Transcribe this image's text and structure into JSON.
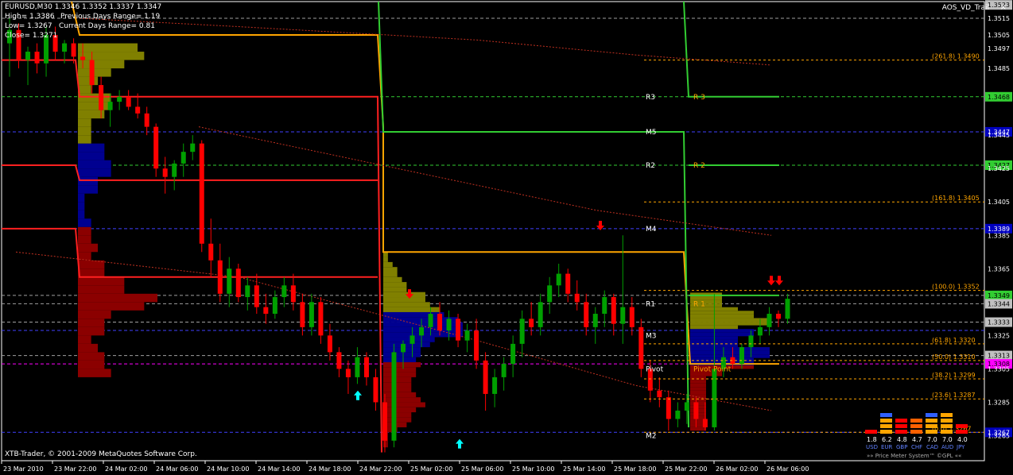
{
  "header": {
    "symbol_line": "EURUSD,M30  1.3346 1.3352 1.3337 1.3347",
    "high": "High= 1.3386",
    "prev_range": "Previous Days Range= 1.19",
    "low": "Low= 1.3267",
    "cur_range": "Current Days Range= 0.81",
    "close": "Close= 1.3271"
  },
  "indicator": {
    "name": "AOS_VD_Trail",
    "close_glyph": "×"
  },
  "copyright": "XTB-Trader, © 2001-2009 MetaQuotes Software Corp.",
  "colors": {
    "background": "#000000",
    "bull": "#00a000",
    "bear": "#ff0000",
    "orange": "#ffa500",
    "green_line": "#32cd32",
    "red_line": "#ff2020",
    "blue_dash": "#3030c0",
    "vp_olive": "#808000",
    "vp_navy": "#000090",
    "vp_maroon": "#8b0000",
    "cyan": "#00ffff",
    "magenta": "#ff00ff",
    "axis_label_bg": "#c0c0c0"
  },
  "chart_data": {
    "type": "candlestick",
    "symbol": "EURUSD",
    "timeframe": "M30",
    "ylim": [
      1.325,
      1.3525
    ],
    "price_labels": [
      {
        "text": "1.3523",
        "value": 1.3523,
        "bg": "#c0c0c0",
        "fg": "#000"
      },
      {
        "text": "1.3515",
        "value": 1.3515,
        "bg": "#000",
        "fg": "#fff"
      },
      {
        "text": "1.3505",
        "value": 1.3505,
        "bg": "#000",
        "fg": "#fff"
      },
      {
        "text": "1.3497",
        "value": 1.3497,
        "bg": "#000",
        "fg": "#fff"
      },
      {
        "text": "1.3485",
        "value": 1.3485,
        "bg": "#000",
        "fg": "#fff"
      },
      {
        "text": "1.3468",
        "value": 1.3468,
        "bg": "#32cd32",
        "fg": "#000"
      },
      {
        "text": "1.3447",
        "value": 1.3447,
        "bg": "#0000c0",
        "fg": "#fff"
      },
      {
        "text": "1.3445",
        "value": 1.3445,
        "bg": "#000",
        "fg": "#fff"
      },
      {
        "text": "1.3427",
        "value": 1.3427,
        "bg": "#32cd32",
        "fg": "#000"
      },
      {
        "text": "1.3425",
        "value": 1.3425,
        "bg": "#000",
        "fg": "#fff"
      },
      {
        "text": "1.3405",
        "value": 1.3405,
        "bg": "#000",
        "fg": "#fff"
      },
      {
        "text": "1.3389",
        "value": 1.3389,
        "bg": "#0000c0",
        "fg": "#fff"
      },
      {
        "text": "1.3385",
        "value": 1.3385,
        "bg": "#000",
        "fg": "#fff"
      },
      {
        "text": "1.3365",
        "value": 1.3365,
        "bg": "#000",
        "fg": "#fff"
      },
      {
        "text": "1.3349",
        "value": 1.3349,
        "bg": "#32cd32",
        "fg": "#000"
      },
      {
        "text": "1.3344",
        "value": 1.3344,
        "bg": "#c0c0c0",
        "fg": "#000"
      },
      {
        "text": "1.3333",
        "value": 1.3333,
        "bg": "#c0c0c0",
        "fg": "#000"
      },
      {
        "text": "1.3325",
        "value": 1.3325,
        "bg": "#000",
        "fg": "#fff"
      },
      {
        "text": "1.3313",
        "value": 1.3313,
        "bg": "#c0c0c0",
        "fg": "#000"
      },
      {
        "text": "1.3308",
        "value": 1.3308,
        "bg": "#ff00ff",
        "fg": "#000"
      },
      {
        "text": "1.3305",
        "value": 1.3305,
        "bg": "#000",
        "fg": "#fff"
      },
      {
        "text": "1.3285",
        "value": 1.3285,
        "bg": "#000",
        "fg": "#fff"
      },
      {
        "text": "1.3267",
        "value": 1.3267,
        "bg": "#0000c0",
        "fg": "#fff"
      },
      {
        "text": "1.3265",
        "value": 1.3265,
        "bg": "#000",
        "fg": "#fff"
      }
    ],
    "x_labels": [
      "23 Mar 2010",
      "23 Mar 22:00",
      "24 Mar 02:00",
      "24 Mar 06:00",
      "24 Mar 10:00",
      "24 Mar 14:00",
      "24 Mar 18:00",
      "24 Mar 22:00",
      "25 Mar 02:00",
      "25 Mar 06:00",
      "25 Mar 10:00",
      "25 Mar 14:00",
      "25 Mar 18:00",
      "25 Mar 22:00",
      "26 Mar 02:00",
      "26 Mar 06:00"
    ],
    "horizontal_levels": [
      {
        "value": 1.3515,
        "color": "#a0a0a0",
        "dash": true
      },
      {
        "value": 1.3468,
        "color": "#32cd32",
        "dash": true
      },
      {
        "value": 1.3447,
        "color": "#4040ff",
        "dash": true
      },
      {
        "value": 1.3427,
        "color": "#32cd32",
        "dash": true
      },
      {
        "value": 1.3389,
        "color": "#4040ff",
        "dash": true
      },
      {
        "value": 1.3349,
        "color": "#a0a0a0",
        "dash": true
      },
      {
        "value": 1.3344,
        "color": "#a0a0a0",
        "dash": true
      },
      {
        "value": 1.3333,
        "color": "#a0a0a0",
        "dash": true
      },
      {
        "value": 1.3328,
        "color": "#4040ff",
        "dash": true
      },
      {
        "value": 1.3313,
        "color": "#a0a0a0",
        "dash": true
      },
      {
        "value": 1.3308,
        "color": "#ff00ff",
        "dash": true
      },
      {
        "value": 1.3267,
        "color": "#4040ff",
        "dash": true
      }
    ],
    "pivot_labels": [
      {
        "text": "R3",
        "value": 1.3468
      },
      {
        "text": "M5",
        "value": 1.3447
      },
      {
        "text": "R2",
        "value": 1.3427
      },
      {
        "text": "M4",
        "value": 1.3389
      },
      {
        "text": "R1",
        "value": 1.3344
      },
      {
        "text": "M3",
        "value": 1.3325
      },
      {
        "text": "Pivot",
        "value": 1.3305
      },
      {
        "text": "M2",
        "value": 1.3265
      }
    ],
    "orange_pivot_labels": [
      {
        "text": "R 3",
        "value": 1.3468
      },
      {
        "text": "R 2",
        "value": 1.3427
      },
      {
        "text": "R 1",
        "value": 1.3344
      },
      {
        "text": "Pivot Point",
        "value": 1.3305
      }
    ],
    "fib_levels": [
      {
        "text": "(261.8)  1.3490",
        "value": 1.349
      },
      {
        "text": "(161.8)  1.3405",
        "value": 1.3405
      },
      {
        "text": "(100.0)  1.3352",
        "value": 1.3352
      },
      {
        "text": "(61.8)  1.3320",
        "value": 1.332
      },
      {
        "text": "(50.0)  1.3310",
        "value": 1.331
      },
      {
        "text": "(38.2)  1.3299",
        "value": 1.3299
      },
      {
        "text": "(23.6)  1.3287",
        "value": 1.3287
      },
      {
        "text": "(0.0)  1.3267",
        "value": 1.3267
      }
    ],
    "currency_meter": {
      "values": [
        "1.8",
        "6.2",
        "4.8",
        "4.7",
        "7.0",
        "7.0",
        "4.0"
      ],
      "currencies": [
        "USD",
        "EUR",
        "GBP",
        "CHF",
        "CAD",
        "AUD",
        "JPY"
      ],
      "caption": "»» Price Meter System™ ©GPL ««"
    },
    "candles": [
      {
        "o": 1.35,
        "h": 1.3515,
        "l": 1.348,
        "c": 1.3508
      },
      {
        "o": 1.3508,
        "h": 1.3512,
        "l": 1.3485,
        "c": 1.349
      },
      {
        "o": 1.349,
        "h": 1.3498,
        "l": 1.3475,
        "c": 1.3495
      },
      {
        "o": 1.3495,
        "h": 1.35,
        "l": 1.3482,
        "c": 1.3488
      },
      {
        "o": 1.3488,
        "h": 1.351,
        "l": 1.348,
        "c": 1.3505
      },
      {
        "o": 1.3505,
        "h": 1.351,
        "l": 1.349,
        "c": 1.3495
      },
      {
        "o": 1.3495,
        "h": 1.3502,
        "l": 1.3488,
        "c": 1.35
      },
      {
        "o": 1.35,
        "h": 1.3503,
        "l": 1.3488,
        "c": 1.3492
      },
      {
        "o": 1.3492,
        "h": 1.35,
        "l": 1.3485,
        "c": 1.349
      },
      {
        "o": 1.349,
        "h": 1.3495,
        "l": 1.347,
        "c": 1.3475
      },
      {
        "o": 1.3475,
        "h": 1.348,
        "l": 1.3455,
        "c": 1.346
      },
      {
        "o": 1.346,
        "h": 1.347,
        "l": 1.345,
        "c": 1.3465
      },
      {
        "o": 1.3465,
        "h": 1.3472,
        "l": 1.346,
        "c": 1.3468
      },
      {
        "o": 1.3468,
        "h": 1.3472,
        "l": 1.346,
        "c": 1.3462
      },
      {
        "o": 1.3462,
        "h": 1.347,
        "l": 1.3455,
        "c": 1.3458
      },
      {
        "o": 1.3458,
        "h": 1.3462,
        "l": 1.3445,
        "c": 1.345
      },
      {
        "o": 1.345,
        "h": 1.3452,
        "l": 1.342,
        "c": 1.3425
      },
      {
        "o": 1.3425,
        "h": 1.3432,
        "l": 1.341,
        "c": 1.342
      },
      {
        "o": 1.342,
        "h": 1.343,
        "l": 1.3412,
        "c": 1.3428
      },
      {
        "o": 1.3428,
        "h": 1.344,
        "l": 1.342,
        "c": 1.3435
      },
      {
        "o": 1.3435,
        "h": 1.3445,
        "l": 1.343,
        "c": 1.344
      },
      {
        "o": 1.344,
        "h": 1.3442,
        "l": 1.3375,
        "c": 1.338
      },
      {
        "o": 1.338,
        "h": 1.3395,
        "l": 1.336,
        "c": 1.337
      },
      {
        "o": 1.337,
        "h": 1.338,
        "l": 1.3345,
        "c": 1.335
      },
      {
        "o": 1.335,
        "h": 1.3372,
        "l": 1.3342,
        "c": 1.3365
      },
      {
        "o": 1.3365,
        "h": 1.3368,
        "l": 1.3345,
        "c": 1.3348
      },
      {
        "o": 1.3348,
        "h": 1.336,
        "l": 1.334,
        "c": 1.3355
      },
      {
        "o": 1.3355,
        "h": 1.3362,
        "l": 1.3338,
        "c": 1.3342
      },
      {
        "o": 1.3342,
        "h": 1.335,
        "l": 1.3332,
        "c": 1.3338
      },
      {
        "o": 1.3338,
        "h": 1.3352,
        "l": 1.3335,
        "c": 1.3348
      },
      {
        "o": 1.3348,
        "h": 1.336,
        "l": 1.3342,
        "c": 1.3355
      },
      {
        "o": 1.3355,
        "h": 1.3362,
        "l": 1.334,
        "c": 1.3345
      },
      {
        "o": 1.3345,
        "h": 1.335,
        "l": 1.3325,
        "c": 1.333
      },
      {
        "o": 1.333,
        "h": 1.335,
        "l": 1.3325,
        "c": 1.3345
      },
      {
        "o": 1.3345,
        "h": 1.3348,
        "l": 1.332,
        "c": 1.3325
      },
      {
        "o": 1.3325,
        "h": 1.3332,
        "l": 1.331,
        "c": 1.3315
      },
      {
        "o": 1.3315,
        "h": 1.3318,
        "l": 1.33,
        "c": 1.3305
      },
      {
        "o": 1.3305,
        "h": 1.331,
        "l": 1.329,
        "c": 1.33
      },
      {
        "o": 1.33,
        "h": 1.3318,
        "l": 1.3296,
        "c": 1.3312
      },
      {
        "o": 1.3312,
        "h": 1.3315,
        "l": 1.3295,
        "c": 1.33
      },
      {
        "o": 1.33,
        "h": 1.3305,
        "l": 1.328,
        "c": 1.3285
      },
      {
        "o": 1.3285,
        "h": 1.329,
        "l": 1.3255,
        "c": 1.3262
      },
      {
        "o": 1.3262,
        "h": 1.332,
        "l": 1.3258,
        "c": 1.3315
      },
      {
        "o": 1.3315,
        "h": 1.3322,
        "l": 1.3305,
        "c": 1.332
      },
      {
        "o": 1.332,
        "h": 1.333,
        "l": 1.3312,
        "c": 1.3325
      },
      {
        "o": 1.3325,
        "h": 1.3335,
        "l": 1.3318,
        "c": 1.333
      },
      {
        "o": 1.333,
        "h": 1.3342,
        "l": 1.3325,
        "c": 1.3338
      },
      {
        "o": 1.3338,
        "h": 1.3345,
        "l": 1.3325,
        "c": 1.3328
      },
      {
        "o": 1.3328,
        "h": 1.334,
        "l": 1.3322,
        "c": 1.3335
      },
      {
        "o": 1.3335,
        "h": 1.3338,
        "l": 1.3318,
        "c": 1.3322
      },
      {
        "o": 1.3322,
        "h": 1.3332,
        "l": 1.3315,
        "c": 1.3328
      },
      {
        "o": 1.3328,
        "h": 1.3335,
        "l": 1.3305,
        "c": 1.331
      },
      {
        "o": 1.331,
        "h": 1.3315,
        "l": 1.328,
        "c": 1.329
      },
      {
        "o": 1.329,
        "h": 1.3305,
        "l": 1.3282,
        "c": 1.33
      },
      {
        "o": 1.33,
        "h": 1.3312,
        "l": 1.3292,
        "c": 1.3308
      },
      {
        "o": 1.3308,
        "h": 1.3325,
        "l": 1.33,
        "c": 1.332
      },
      {
        "o": 1.332,
        "h": 1.334,
        "l": 1.3312,
        "c": 1.3335
      },
      {
        "o": 1.3335,
        "h": 1.3345,
        "l": 1.3325,
        "c": 1.333
      },
      {
        "o": 1.333,
        "h": 1.335,
        "l": 1.3325,
        "c": 1.3345
      },
      {
        "o": 1.3345,
        "h": 1.336,
        "l": 1.3338,
        "c": 1.3355
      },
      {
        "o": 1.3355,
        "h": 1.3368,
        "l": 1.3348,
        "c": 1.3362
      },
      {
        "o": 1.3362,
        "h": 1.3365,
        "l": 1.3345,
        "c": 1.335
      },
      {
        "o": 1.335,
        "h": 1.3358,
        "l": 1.334,
        "c": 1.3345
      },
      {
        "o": 1.3345,
        "h": 1.335,
        "l": 1.3325,
        "c": 1.333
      },
      {
        "o": 1.333,
        "h": 1.3342,
        "l": 1.332,
        "c": 1.3338
      },
      {
        "o": 1.3338,
        "h": 1.3352,
        "l": 1.333,
        "c": 1.3348
      },
      {
        "o": 1.3348,
        "h": 1.335,
        "l": 1.3325,
        "c": 1.3332
      },
      {
        "o": 1.3332,
        "h": 1.3385,
        "l": 1.332,
        "c": 1.3342
      },
      {
        "o": 1.3342,
        "h": 1.3348,
        "l": 1.3325,
        "c": 1.333
      },
      {
        "o": 1.333,
        "h": 1.3335,
        "l": 1.33,
        "c": 1.3305
      },
      {
        "o": 1.3305,
        "h": 1.331,
        "l": 1.3285,
        "c": 1.3292
      },
      {
        "o": 1.3292,
        "h": 1.33,
        "l": 1.3282,
        "c": 1.3288
      },
      {
        "o": 1.3288,
        "h": 1.3292,
        "l": 1.3268,
        "c": 1.3275
      },
      {
        "o": 1.3275,
        "h": 1.3285,
        "l": 1.327,
        "c": 1.328
      },
      {
        "o": 1.328,
        "h": 1.329,
        "l": 1.3272,
        "c": 1.3285
      },
      {
        "o": 1.3285,
        "h": 1.3288,
        "l": 1.327,
        "c": 1.3275
      },
      {
        "o": 1.3275,
        "h": 1.3285,
        "l": 1.3268,
        "c": 1.327
      },
      {
        "o": 1.327,
        "h": 1.335,
        "l": 1.3268,
        "c": 1.3305
      },
      {
        "o": 1.3305,
        "h": 1.3318,
        "l": 1.33,
        "c": 1.3312
      },
      {
        "o": 1.3312,
        "h": 1.3318,
        "l": 1.3305,
        "c": 1.3308
      },
      {
        "o": 1.3308,
        "h": 1.332,
        "l": 1.3305,
        "c": 1.3318
      },
      {
        "o": 1.3318,
        "h": 1.3328,
        "l": 1.3312,
        "c": 1.3325
      },
      {
        "o": 1.3325,
        "h": 1.3335,
        "l": 1.332,
        "c": 1.333
      },
      {
        "o": 1.333,
        "h": 1.3342,
        "l": 1.3325,
        "c": 1.3338
      },
      {
        "o": 1.3338,
        "h": 1.334,
        "l": 1.333,
        "c": 1.3335
      },
      {
        "o": 1.3335,
        "h": 1.335,
        "l": 1.3332,
        "c": 1.3347
      }
    ]
  }
}
